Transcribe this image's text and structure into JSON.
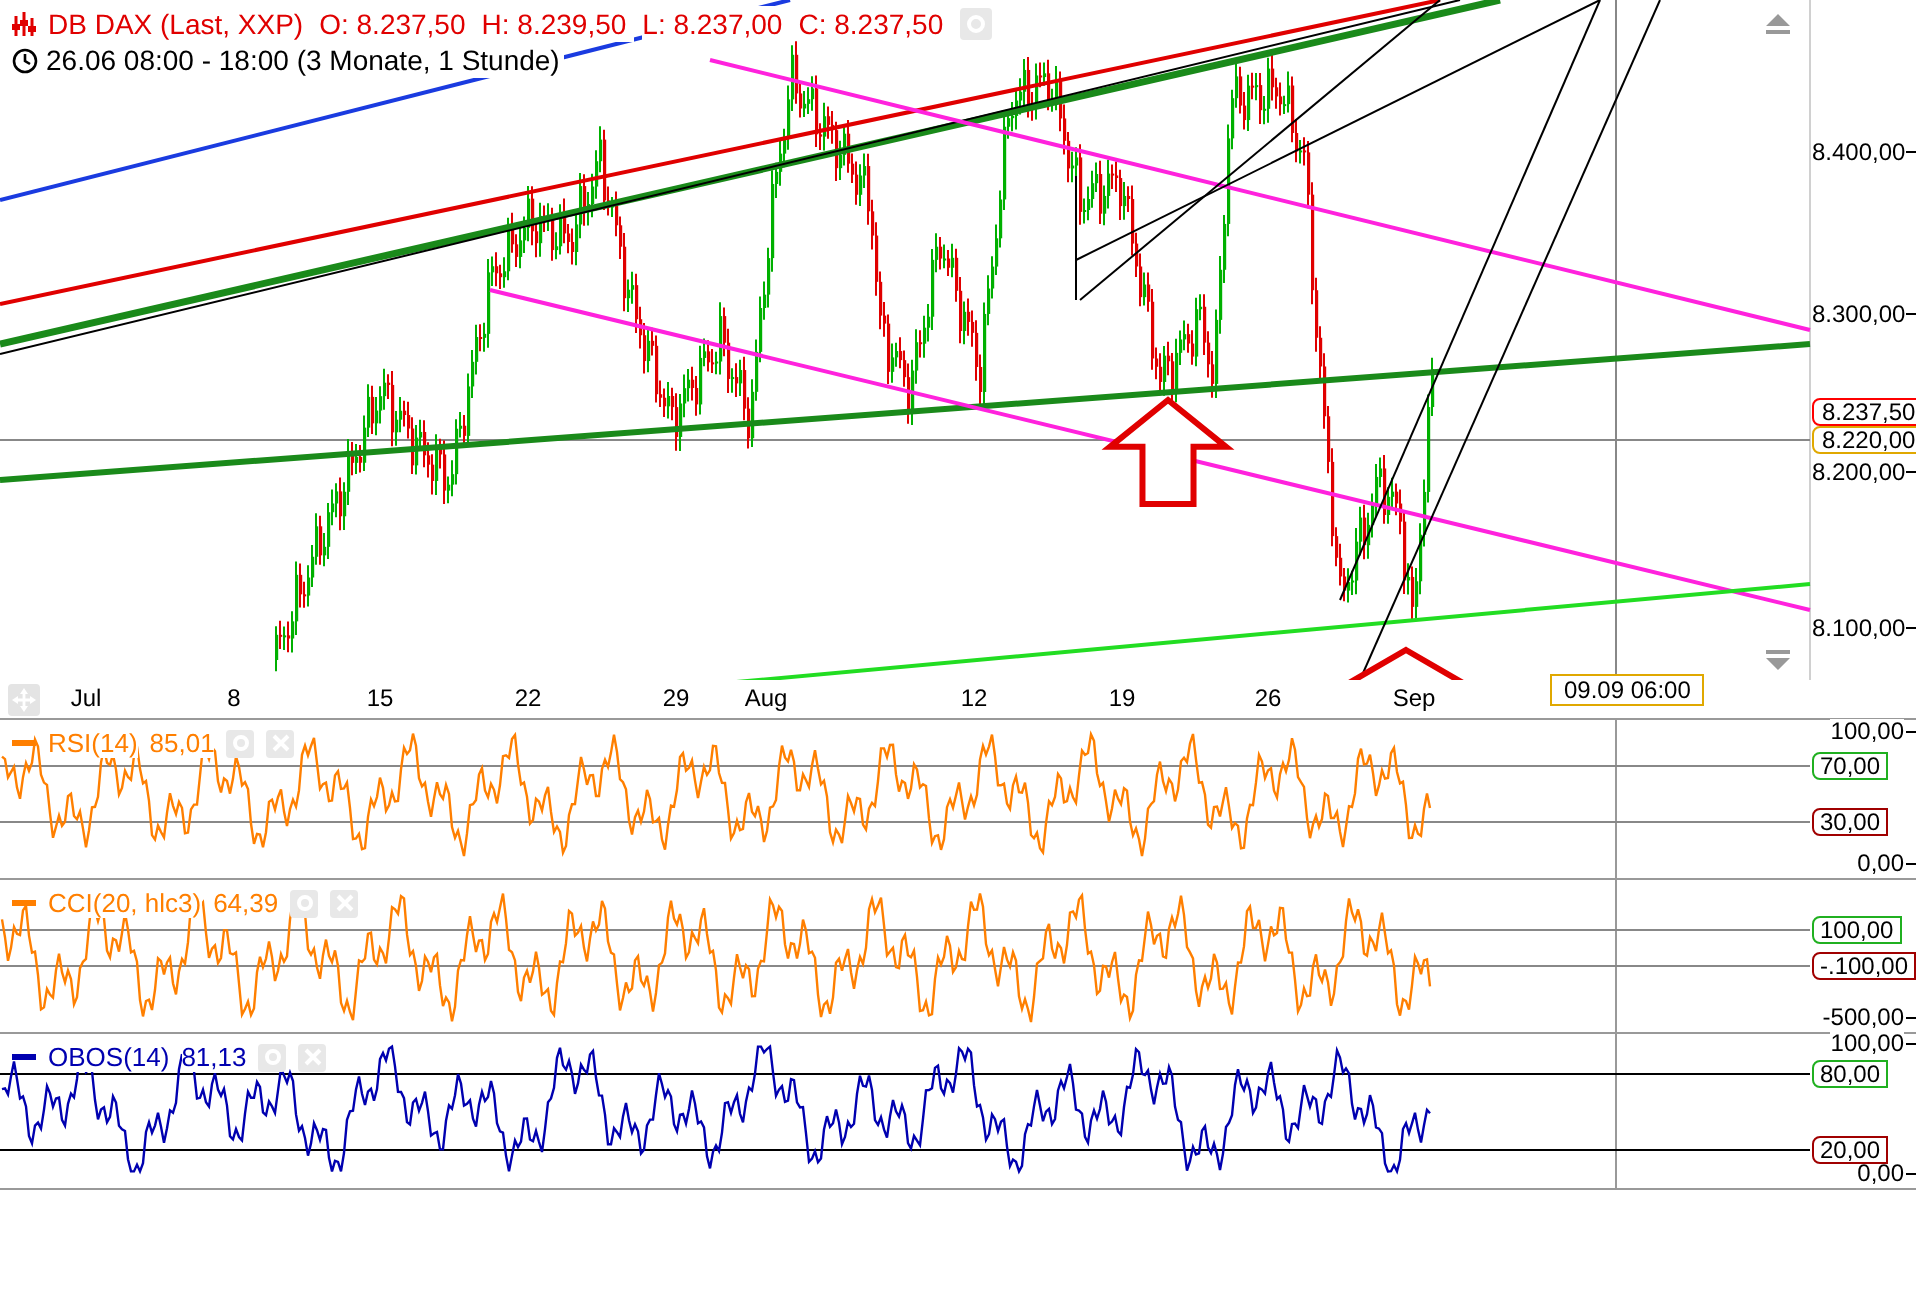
{
  "header": {
    "title": "DB DAX (Last, XXP)",
    "ohlc": [
      {
        "label": "O:",
        "value": "8.237,50"
      },
      {
        "label": "H:",
        "value": "8.239,50"
      },
      {
        "label": "L:",
        "value": "8.237,00"
      },
      {
        "label": "C:",
        "value": "8.237,50"
      }
    ],
    "range": "26.06 08:00 - 18:00 (3 Monate, 1 Stunde)"
  },
  "price_axis": {
    "ticks": [
      "8.400,00",
      "8.300,00",
      "8.200,00",
      "8.100,00"
    ],
    "tags": [
      {
        "text": "8.237,50",
        "color": "#ff0000"
      },
      {
        "text": "8.220,00",
        "color": "#e0a800"
      }
    ]
  },
  "time_axis": {
    "labels": [
      "Jul",
      "8",
      "15",
      "22",
      "29",
      "Aug",
      "12",
      "19",
      "26",
      "Sep"
    ],
    "cursor": "09.09 06:00"
  },
  "indicators": [
    {
      "name": "RSI(14)",
      "value": "85,01",
      "color": "#ff7f00",
      "axis": [
        "100,00",
        "0,00"
      ],
      "levels": [
        {
          "text": "70,00",
          "kind": "upper"
        },
        {
          "text": "30,00",
          "kind": "lower"
        }
      ]
    },
    {
      "name": "CCI(20, hlc3)",
      "value": "64,39",
      "color": "#ff7f00",
      "axis": [
        "-500,00"
      ],
      "levels": [
        {
          "text": "100,00",
          "kind": "upper"
        },
        {
          "text": "-.100,00",
          "kind": "lower"
        }
      ]
    },
    {
      "name": "OBOS(14)",
      "value": "81,13",
      "color": "#0000b0",
      "axis": [
        "100,00",
        "0,00"
      ],
      "levels": [
        {
          "text": "80,00",
          "kind": "upper"
        },
        {
          "text": "20,00",
          "kind": "lower"
        }
      ]
    }
  ]
}
